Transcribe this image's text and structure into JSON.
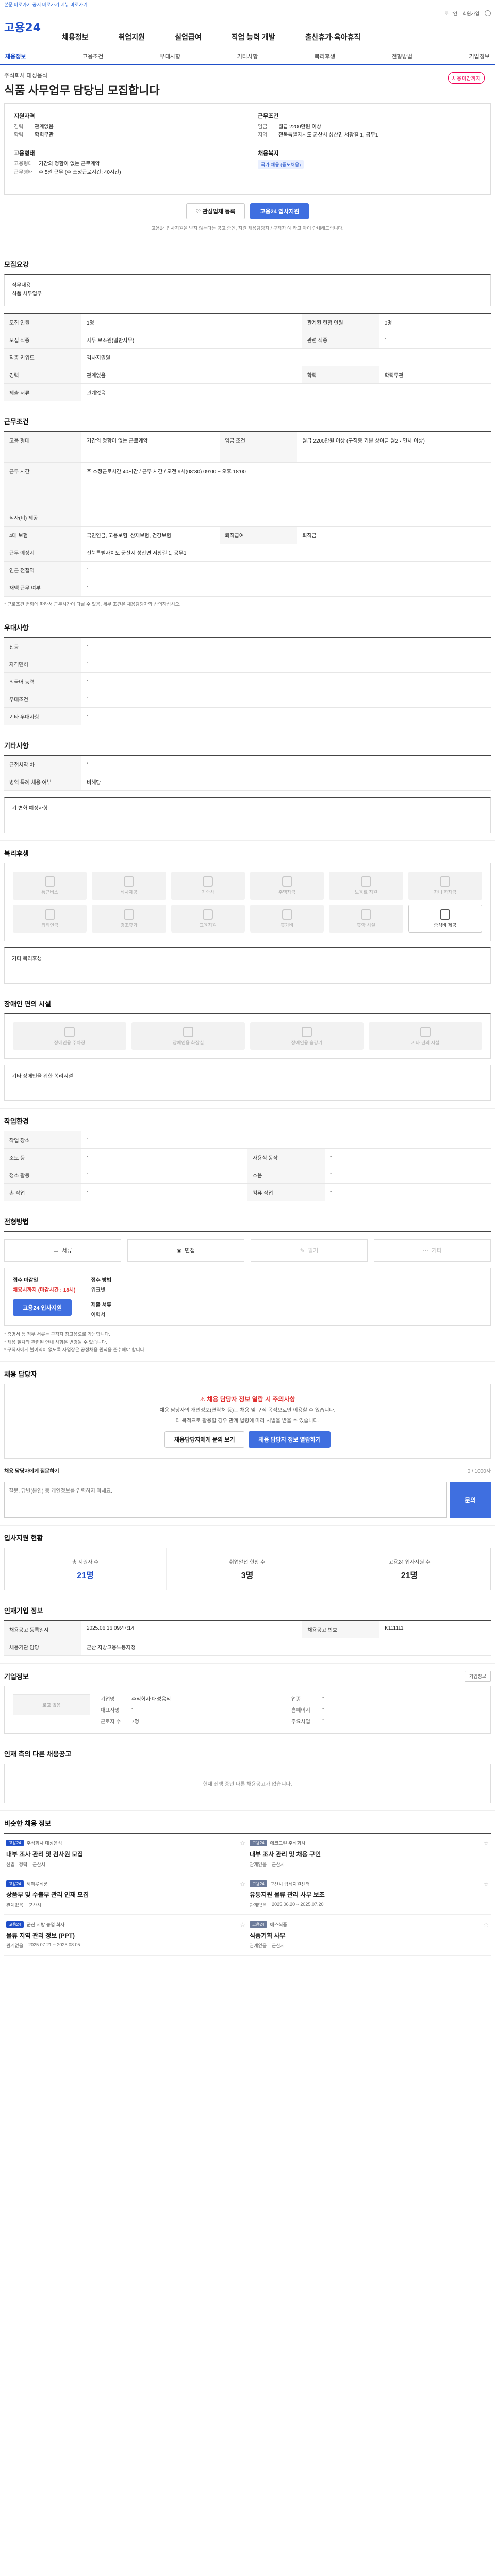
{
  "skip_link": "본문 바로가기 공지 바로가기 메뉴 바로가기",
  "header": {
    "logo": "고용24",
    "util": [
      "로그인",
      "회원가입"
    ],
    "gnb": [
      "채용정보",
      "취업지원",
      "실업급여",
      "직업 능력 개발",
      "출산휴가·육아휴직"
    ]
  },
  "subnav": [
    "채용정보",
    "고용조건",
    "우대사항",
    "기타사항",
    "복리후생",
    "전형방법",
    "기업정보"
  ],
  "job": {
    "company": "주식회사 대성음식",
    "title": "식품 사무업무 담당님 모집합니다",
    "dday": "채용마감까지"
  },
  "summary": {
    "left": {
      "title1": "지원자격",
      "rows1": [
        {
          "k": "경력",
          "v": "관계없음"
        },
        {
          "k": "학력",
          "v": "학력무관"
        }
      ],
      "title2": "고용형태",
      "rows2": [
        {
          "k": "고용형태",
          "v": "기간의 정함이 없는 근로계약"
        },
        {
          "k": "근무형태",
          "v": "주 5일 근무 (주 소정근로시간: 40시간)"
        }
      ]
    },
    "right": {
      "title1": "근무조건",
      "rows1": [
        {
          "k": "임금",
          "v": "월급 2200만원 이상"
        },
        {
          "k": "지역",
          "v": "전북특별자치도 군산시 성산면 서황길 1, 공무1"
        }
      ],
      "title2": "채용복지",
      "tag": "국가 채용 (중도채용)"
    }
  },
  "actions": {
    "scrap": "관심업체 등록",
    "apply": "고용24 입사지원",
    "note": "고용24 입사지원을 받지 않는다는 공고 중엔, 지원 채용담당자 / 구직자 예 라고 아이 안내해드립니다."
  },
  "sections": {
    "recruit": {
      "title": "모집요강",
      "job_box": [
        "직무내용",
        "식품 사무업무"
      ],
      "rows": [
        [
          "모집 인원",
          "1명",
          "관계된 현황 인원",
          "0명"
        ],
        [
          "모집 직종",
          "사무 보조원(일반사무)",
          "관련 직종",
          "-"
        ],
        [
          "직종 키워드",
          "검사지원원",
          "",
          ""
        ],
        [
          "경력",
          "관계없음",
          "학력",
          "학력무관"
        ],
        [
          "제출 서류",
          "관계없음",
          "",
          ""
        ]
      ]
    },
    "conditions": {
      "title": "근무조건",
      "rows": [
        [
          "고용 형태",
          "기간의 정함이 없는 근로계약",
          "임금 조건",
          "월급 2200만원 이상 (구직중 기본 상여금 월2 · 연차 이상)"
        ],
        [
          "근무 시간",
          "주 소정근로시간 40시간 / 근무 시간 / 오전 9시(08:30) 09:00 ~ 오후 18:00",
          "",
          ""
        ],
        [
          "식사(비) 제공",
          "",
          "",
          ""
        ],
        [
          "4대 보험",
          "국민연금, 고용보험, 산재보험, 건강보험",
          "퇴직급여",
          "퇴직금"
        ],
        [
          "근무 예정지",
          "전북특별자치도 군산시 성산면 서황길 1, 공무1",
          "",
          ""
        ],
        [
          "인근 전철역",
          "-",
          "",
          ""
        ],
        [
          "재택 근무 여부",
          "-",
          "",
          ""
        ]
      ],
      "note": "* 근로조건 변화에 따라서 근무시간이 다를 수 있음. 세부 조건은 채용담당자와 상의하십시오."
    },
    "preference": {
      "title": "우대사항",
      "rows": [
        [
          "전공",
          "-"
        ],
        [
          "자격면허",
          "-"
        ],
        [
          "외국어 능력",
          "-"
        ],
        [
          "우대조건",
          "-"
        ],
        [
          "기타 우대사항",
          "-"
        ]
      ]
    },
    "etc": {
      "title": "기타사항",
      "rows": [
        [
          "근접시작 차",
          "-"
        ],
        [
          "병역 특례 채용 여부",
          "비해당"
        ]
      ],
      "box": "기 변화 예정사항"
    },
    "welfare": {
      "title": "복리후생",
      "items": [
        "통근버스",
        "식사제공",
        "기숙사",
        "주택자금",
        "보육료 지원",
        "자녀 학자금",
        "퇴직연금",
        "경조휴가",
        "교육지원",
        "휴가비",
        "휴양 시설",
        "중식비 제공"
      ],
      "box": "기타 복리후생"
    },
    "disabled": {
      "title": "장애인 편의 시설",
      "items": [
        "장애인용 주차장",
        "장애인용 화장실",
        "장애인용 승강기",
        "기타 편의 시설"
      ],
      "box": "기타 장애인을 위한 복리시설"
    },
    "worksite": {
      "title": "작업환경",
      "rows": [
        [
          "작업 장소",
          "-",
          "",
          ""
        ],
        [
          "조도 등",
          "-",
          "사용식 동작",
          "-"
        ],
        [
          "청소 활동",
          "-",
          "소음",
          "-"
        ],
        [
          "손 작업",
          "-",
          "컴퓨 작업",
          "-"
        ]
      ]
    },
    "process": {
      "title": "전형방법",
      "methods": [
        {
          "label": "서류",
          "off": false
        },
        {
          "label": "면접",
          "off": false
        },
        {
          "label": "필기",
          "off": true
        },
        {
          "label": "기타",
          "off": true
        }
      ],
      "apply": {
        "k1": "접수 마감일",
        "v1": "채용시까지 (마감시간 : 18시)",
        "k2": "접수 방법",
        "v2": "워크넷",
        "btn": "고용24 입사지원",
        "k3": "제출 서류",
        "v3": "이력서"
      },
      "notices": [
        "* 증명서 등 첨부 서류는 구직자 참고용으로 가능합니다.",
        "* 채용 절차와 관련된 안내 사항은 변경될 수 있습니다.",
        "* 구직자에게 불이익이 없도록 사업장은 공정채용 원칙을 준수해야 합니다."
      ]
    },
    "consult": {
      "title": "채용 담당자",
      "warn": "채용 담당자 정보 열람 시 주의사항",
      "text": "채용 담당자의 개인정보(연락처 등)는 채용 및 구직 목적으로만 이용할 수 있습니다.",
      "text2": "타 목적으로 활용할 경우 관계 법령에 따라 처벌을 받을 수 있습니다.",
      "btn1": "채용담당자에게 문의 보기",
      "btn2": "채용 담당자 정보 열람하기",
      "qa_label": "채용 담당자에게 질문하기",
      "qa_count": "0 / 1000자",
      "qa_placeholder": "질문, 답변(본인) 등 개인정보를 입력하지 마세요.",
      "send": "문의"
    },
    "stats": {
      "title": "입사지원 현황",
      "items": [
        {
          "k": "총 지원자 수",
          "v": "21명"
        },
        {
          "k": "취업알선 현황 수",
          "v": "3명"
        },
        {
          "k": "고용24 입사지원 수",
          "v": "21명"
        }
      ]
    },
    "infra": {
      "title": "인재기업 정보",
      "rows": [
        [
          "채용공고 등록일시",
          "2025.06.16 09:47:14",
          "채용공고 번호",
          "K111111"
        ],
        [
          "채용기관 담당",
          "군산 지방고용노동지청",
          "",
          ""
        ]
      ]
    },
    "company": {
      "title": "기업정보",
      "more": "기업정보",
      "logo": "로고 없음",
      "fields": [
        [
          "기업명",
          "주식회사 대성음식"
        ],
        [
          "업종",
          "-"
        ],
        [
          "대표자명",
          "-"
        ],
        [
          "홈페이지",
          "-"
        ],
        [
          "근로자 수",
          "7명"
        ],
        [
          "주요사업",
          "-"
        ]
      ]
    },
    "others": {
      "title": "인재 측의 다른 채용공고",
      "empty": "현재 진행 중인 다른 채용공고가 없습니다."
    },
    "recommend": {
      "title": "비슷한 채용 정보",
      "items": [
        {
          "badge": "고용24",
          "org": "주식회사 대성음식",
          "title": "내부 조사 관리 및 검사원 모집",
          "meta": [
            "신입 · 경력",
            "군산시"
          ]
        },
        {
          "badge": "고용24",
          "org": "에코그린 주식회사",
          "title": "내부 조사 관리 및 채용 구인",
          "meta": [
            "관계없음",
            "군산시"
          ]
        },
        {
          "badge": "고용24",
          "org": "해마루식품",
          "title": "상품부 및 수출부 관리 인재 모집",
          "meta": [
            "관계없음",
            "군산시"
          ]
        },
        {
          "badge": "고용24",
          "org": "군산시 급식지원센터",
          "title": "유통지원 물류 관리 사무 보조",
          "meta": [
            "관계없음",
            "2025.06.20 ~ 2025.07.20"
          ]
        },
        {
          "badge": "고용24",
          "org": "군산 지방 농업 회사",
          "title": "물류 지역 관리 정보 (PPT)",
          "meta": [
            "관계없음",
            "2025.07.21 ~ 2025.08.05"
          ]
        },
        {
          "badge": "고용24",
          "org": "에스식품",
          "title": "식품기획 사무",
          "meta": [
            "관계없음",
            "군산시"
          ]
        }
      ]
    }
  }
}
